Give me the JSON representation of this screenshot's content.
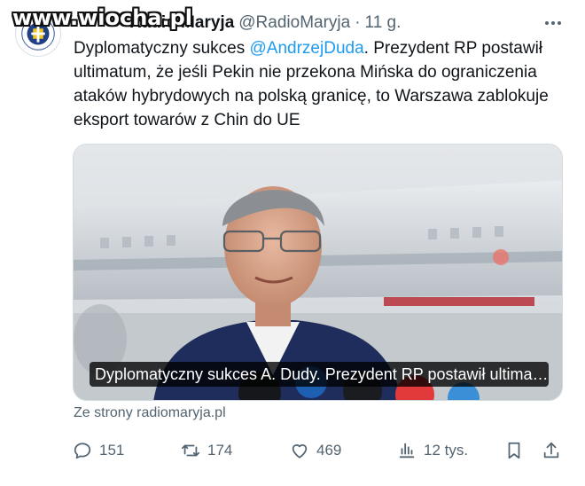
{
  "watermark": "www.wiocha.pl",
  "author": {
    "display_name": "Radio Maryja",
    "handle": "@RadioMaryja",
    "separator": "·",
    "time": "11 g.",
    "avatar_icon": "radio-maryja-logo-icon"
  },
  "tweet": {
    "text_before": "Dyplomatyczny sukces ",
    "mention": "@AndrzejDuda",
    "text_after": ". Prezydent RP postawił ultimatum, że jeśli Pekin nie przekona Mińska do ograniczenia ataków hybrydowych na polską granicę, to Warszawa zablokuje eksport towarów z Chin do UE"
  },
  "card": {
    "caption": "Dyplomatyczny sukces A. Dudy. Prezydent RP postawił ultima…",
    "source": "Ze strony radiomaryja.pl"
  },
  "actions": {
    "replies": "151",
    "reposts": "174",
    "likes": "469",
    "views": "12 tys."
  },
  "colors": {
    "accent": "#1d9bf0",
    "muted": "#536471",
    "text": "#0f1419"
  }
}
